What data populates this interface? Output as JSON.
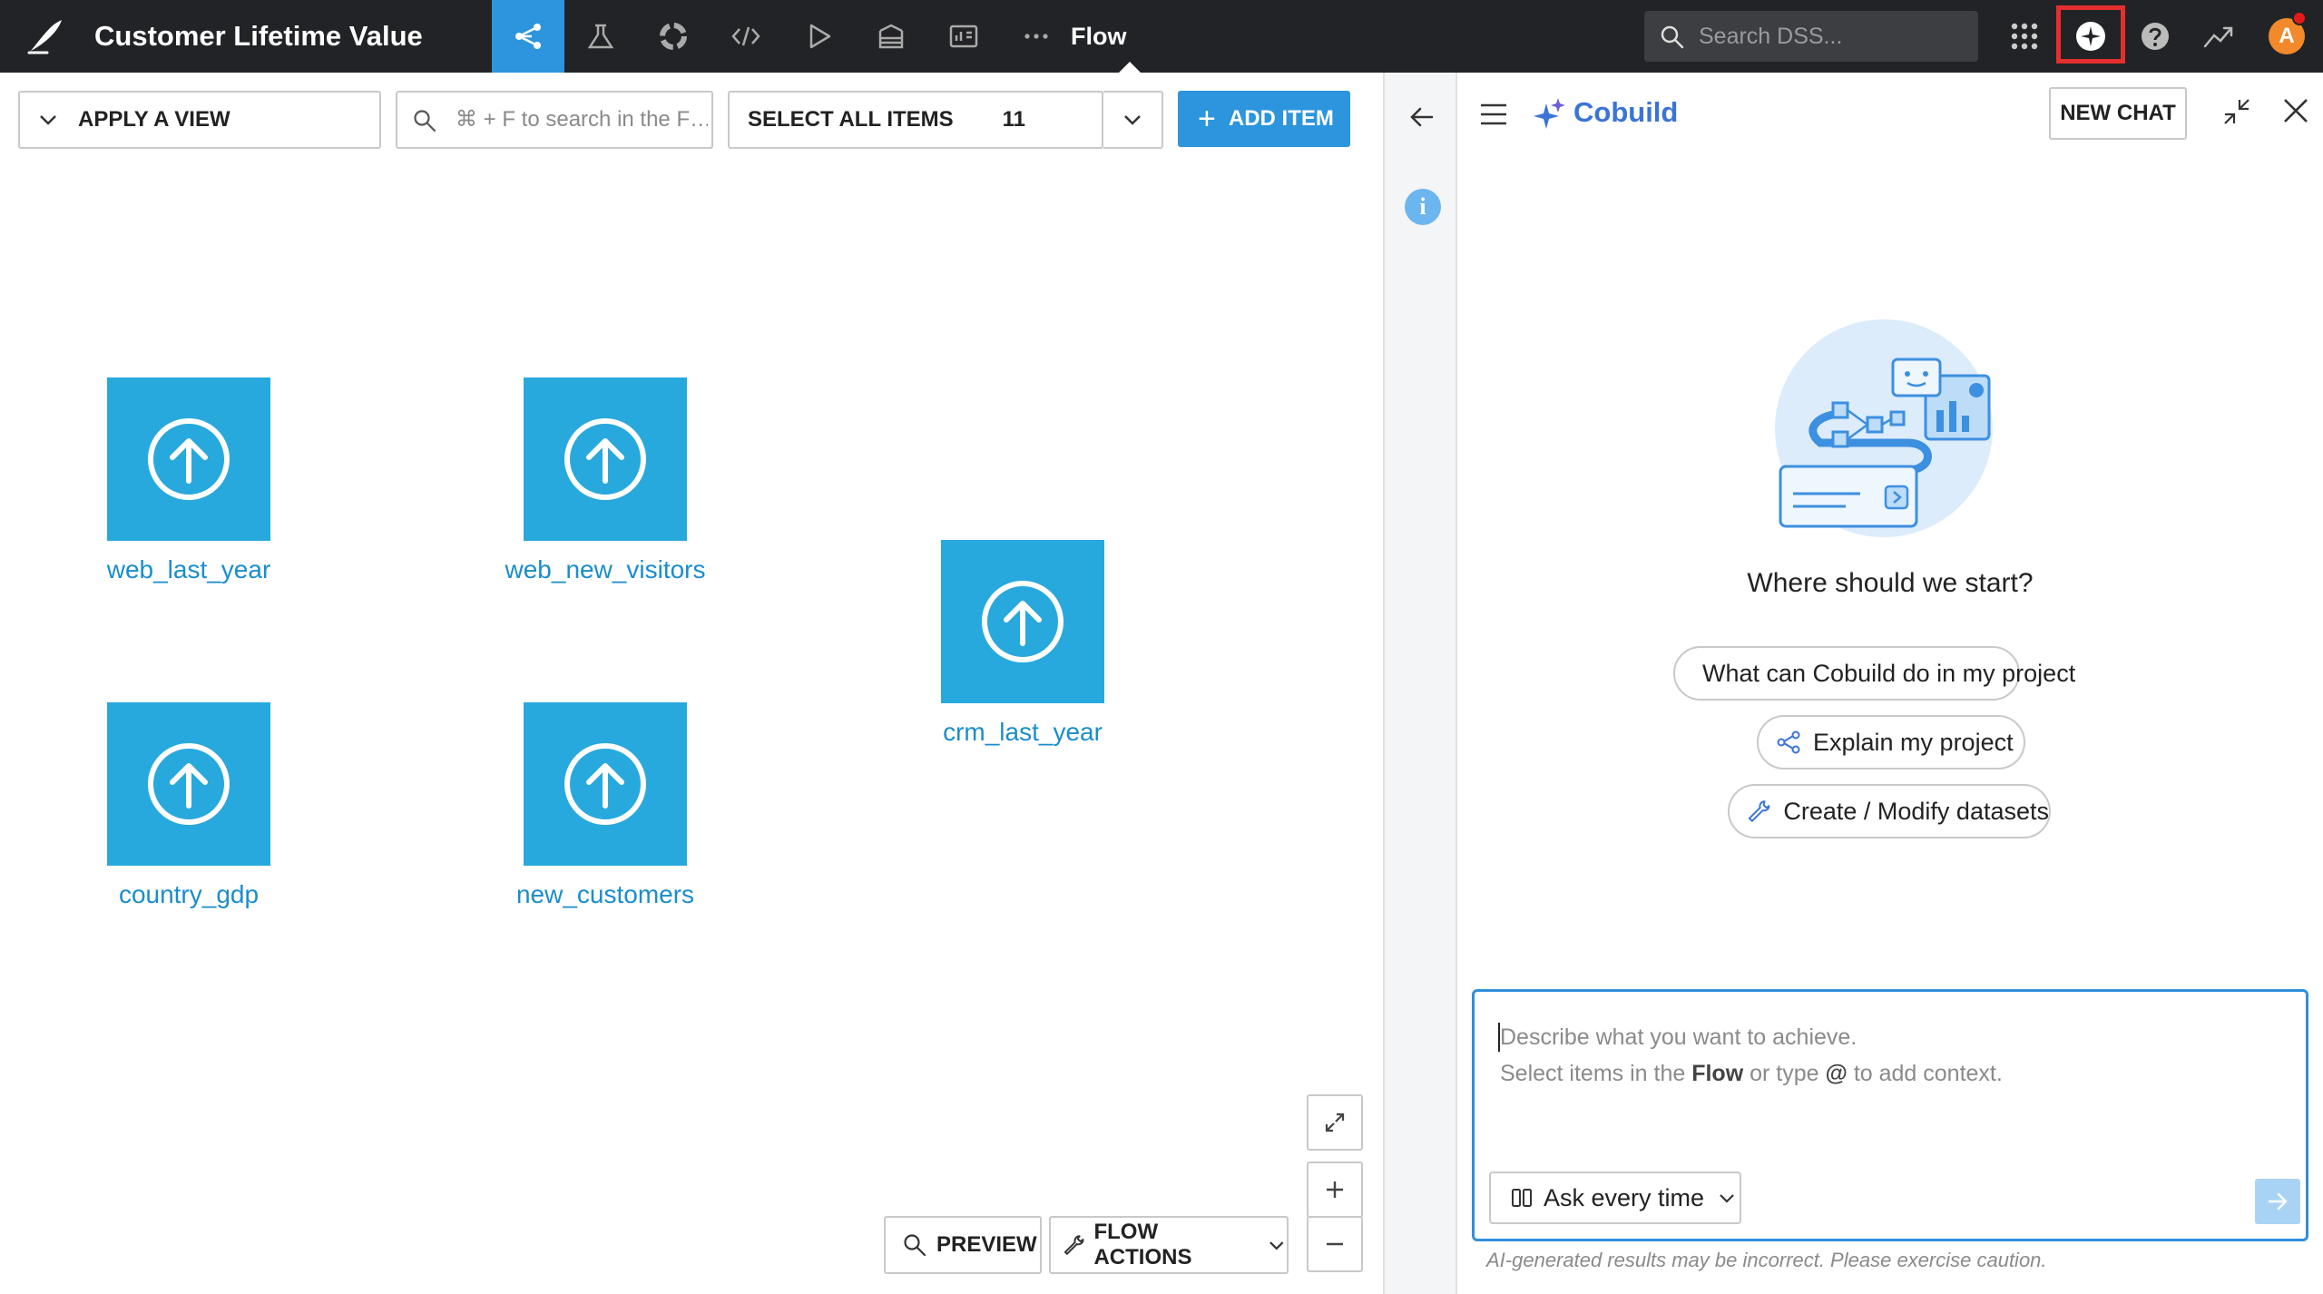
{
  "app": {
    "project_title": "Customer Lifetime Value",
    "current_section": "Flow",
    "search_placeholder": "Search DSS...",
    "avatar_initial": "A"
  },
  "flow_toolbar": {
    "apply_view_label": "APPLY A VIEW",
    "search_placeholder": "⌘ + F to search in the F…",
    "select_all_label": "SELECT ALL ITEMS",
    "item_count": "11",
    "add_item_label": "ADD ITEM"
  },
  "datasets": [
    {
      "name": "web_last_year",
      "icon": "upload-arrow-icon"
    },
    {
      "name": "web_new_visitors",
      "icon": "upload-arrow-icon"
    },
    {
      "name": "crm_last_year",
      "icon": "upload-arrow-icon"
    },
    {
      "name": "country_gdp",
      "icon": "upload-arrow-icon"
    },
    {
      "name": "new_customers",
      "icon": "upload-arrow-icon"
    }
  ],
  "flow_controls": {
    "preview_label": "PREVIEW",
    "flow_actions_label": "FLOW ACTIONS",
    "zoom_in": "+",
    "zoom_out": "−"
  },
  "side_strip": {
    "info_glyph": "i"
  },
  "cobuild": {
    "title": "Cobuild",
    "new_chat_label": "NEW CHAT",
    "prompt_title": "Where should we start?",
    "suggestions": [
      "What can Cobuild do in my project",
      "Explain my project",
      "Create / Modify datasets"
    ],
    "composer_line1": "Describe what you want to achieve.",
    "composer_line2_a": "Select items in the ",
    "composer_line2_b": "Flow",
    "composer_line2_c": " or type ",
    "composer_line2_d": "@",
    "composer_line2_e": " to add context.",
    "mode_label": "Ask every time",
    "disclaimer": "AI-generated results may be incorrect. Please exercise caution."
  },
  "colors": {
    "topbar": "#222326",
    "accent": "#2c95dd",
    "dataset_tile": "#28a9dd",
    "dataset_label": "#1a8dcc",
    "cobuild_title": "#3a74d6",
    "highlight_box": "#e52e2e"
  }
}
